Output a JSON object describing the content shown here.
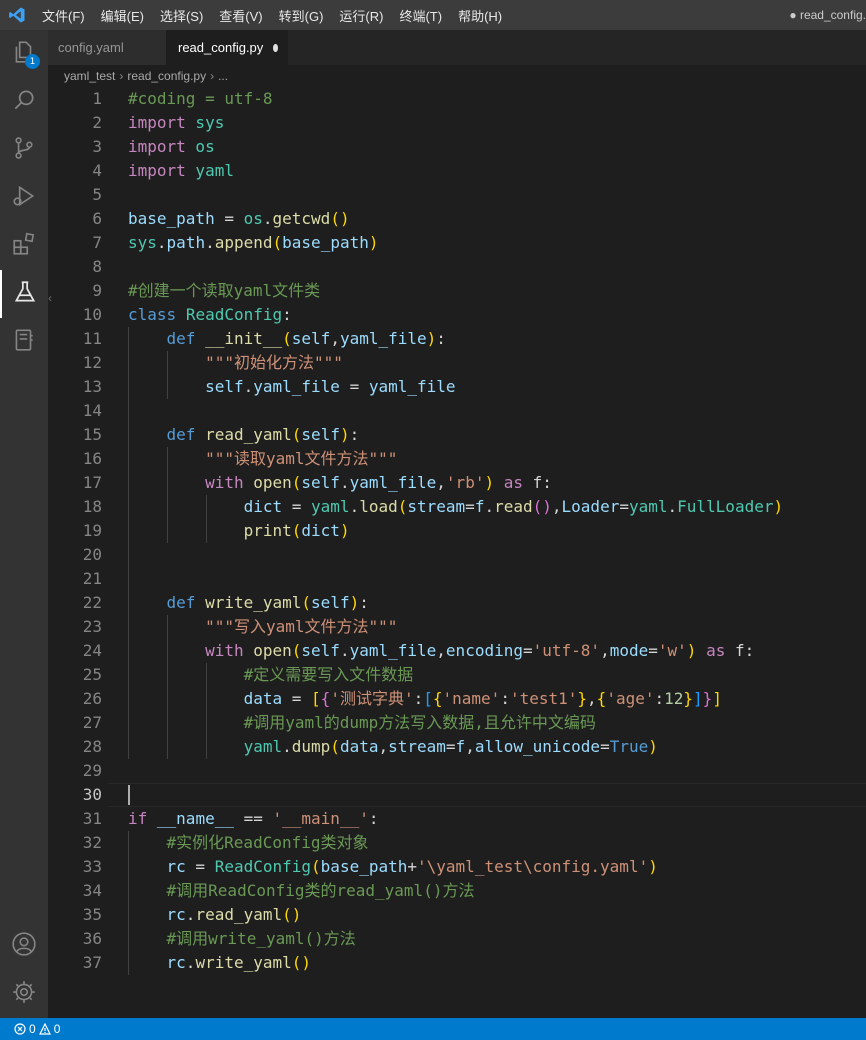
{
  "menu": [
    "文件(F)",
    "编辑(E)",
    "选择(S)",
    "查看(V)",
    "转到(G)",
    "运行(R)",
    "终端(T)",
    "帮助(H)"
  ],
  "window_title": "● read_config.",
  "activity": {
    "icons": [
      "files-icon",
      "search-icon",
      "source-control-icon",
      "run-debug-icon",
      "extensions-icon",
      "testing-icon",
      "notebook-icon",
      "account-icon",
      "settings-gear-icon"
    ],
    "explorer_badge": "1"
  },
  "tabs": [
    {
      "label": "config.yaml",
      "active": false,
      "dirty": false
    },
    {
      "label": "read_config.py",
      "active": true,
      "dirty": true
    }
  ],
  "breadcrumb": [
    "yaml_test",
    "read_config.py",
    "..."
  ],
  "editor": {
    "current_line": 30,
    "lines": [
      [
        [
          "#coding = utf-8",
          "com"
        ]
      ],
      [
        [
          "import",
          "kc"
        ],
        [
          " sys",
          "cls"
        ]
      ],
      [
        [
          "import",
          "kc"
        ],
        [
          " os",
          "cls"
        ]
      ],
      [
        [
          "import",
          "kc"
        ],
        [
          " yaml",
          "cls"
        ]
      ],
      [],
      [
        [
          "base_path",
          "var"
        ],
        [
          " = ",
          "pl"
        ],
        [
          "os",
          "cls"
        ],
        [
          ".",
          "pl"
        ],
        [
          "getcwd",
          "fn"
        ],
        [
          "()",
          "br1"
        ]
      ],
      [
        [
          "sys",
          "cls"
        ],
        [
          ".",
          "pl"
        ],
        [
          "path",
          "var"
        ],
        [
          ".",
          "pl"
        ],
        [
          "append",
          "fn"
        ],
        [
          "(",
          "br1"
        ],
        [
          "base_path",
          "var"
        ],
        [
          ")",
          "br1"
        ]
      ],
      [],
      [
        [
          "#创建一个读取yaml文件类",
          "com"
        ]
      ],
      [
        [
          "class",
          "kw"
        ],
        [
          " ",
          "pl"
        ],
        [
          "ReadConfig",
          "cls"
        ],
        [
          ":",
          "pl"
        ]
      ],
      [
        [
          "    ",
          "pl"
        ],
        [
          "def",
          "kw"
        ],
        [
          " ",
          "pl"
        ],
        [
          "__init__",
          "fn"
        ],
        [
          "(",
          "br1"
        ],
        [
          "self",
          "var"
        ],
        [
          ",",
          "pl"
        ],
        [
          "yaml_file",
          "var"
        ],
        [
          ")",
          "br1"
        ],
        [
          ":",
          "pl"
        ]
      ],
      [
        [
          "        ",
          "pl"
        ],
        [
          "\"\"\"初始化方法\"\"\"",
          "str"
        ]
      ],
      [
        [
          "        ",
          "pl"
        ],
        [
          "self",
          "var"
        ],
        [
          ".",
          "pl"
        ],
        [
          "yaml_file",
          "var"
        ],
        [
          " = ",
          "pl"
        ],
        [
          "yaml_file",
          "var"
        ]
      ],
      [],
      [
        [
          "    ",
          "pl"
        ],
        [
          "def",
          "kw"
        ],
        [
          " ",
          "pl"
        ],
        [
          "read_yaml",
          "fn"
        ],
        [
          "(",
          "br1"
        ],
        [
          "self",
          "var"
        ],
        [
          ")",
          "br1"
        ],
        [
          ":",
          "pl"
        ]
      ],
      [
        [
          "        ",
          "pl"
        ],
        [
          "\"\"\"读取yaml文件方法\"\"\"",
          "str"
        ]
      ],
      [
        [
          "        ",
          "pl"
        ],
        [
          "with",
          "kc"
        ],
        [
          " ",
          "pl"
        ],
        [
          "open",
          "fn"
        ],
        [
          "(",
          "br1"
        ],
        [
          "self",
          "var"
        ],
        [
          ".",
          "pl"
        ],
        [
          "yaml_file",
          "var"
        ],
        [
          ",",
          "pl"
        ],
        [
          "'rb'",
          "str"
        ],
        [
          ")",
          "br1"
        ],
        [
          " ",
          "pl"
        ],
        [
          "as",
          "kc"
        ],
        [
          " f:",
          "pl"
        ]
      ],
      [
        [
          "            ",
          "pl"
        ],
        [
          "dict",
          "var"
        ],
        [
          " = ",
          "pl"
        ],
        [
          "yaml",
          "cls"
        ],
        [
          ".",
          "pl"
        ],
        [
          "load",
          "fn"
        ],
        [
          "(",
          "br1"
        ],
        [
          "stream",
          "var"
        ],
        [
          "=",
          "pl"
        ],
        [
          "f",
          "var"
        ],
        [
          ".",
          "pl"
        ],
        [
          "read",
          "fn"
        ],
        [
          "()",
          "br2"
        ],
        [
          ",",
          "pl"
        ],
        [
          "Loader",
          "var"
        ],
        [
          "=",
          "pl"
        ],
        [
          "yaml",
          "cls"
        ],
        [
          ".",
          "pl"
        ],
        [
          "FullLoader",
          "cls"
        ],
        [
          ")",
          "br1"
        ]
      ],
      [
        [
          "            ",
          "pl"
        ],
        [
          "print",
          "fn"
        ],
        [
          "(",
          "br1"
        ],
        [
          "dict",
          "var"
        ],
        [
          ")",
          "br1"
        ]
      ],
      [],
      [],
      [
        [
          "    ",
          "pl"
        ],
        [
          "def",
          "kw"
        ],
        [
          " ",
          "pl"
        ],
        [
          "write_yaml",
          "fn"
        ],
        [
          "(",
          "br1"
        ],
        [
          "self",
          "var"
        ],
        [
          ")",
          "br1"
        ],
        [
          ":",
          "pl"
        ]
      ],
      [
        [
          "        ",
          "pl"
        ],
        [
          "\"\"\"写入yaml文件方法\"\"\"",
          "str"
        ]
      ],
      [
        [
          "        ",
          "pl"
        ],
        [
          "with",
          "kc"
        ],
        [
          " ",
          "pl"
        ],
        [
          "open",
          "fn"
        ],
        [
          "(",
          "br1"
        ],
        [
          "self",
          "var"
        ],
        [
          ".",
          "pl"
        ],
        [
          "yaml_file",
          "var"
        ],
        [
          ",",
          "pl"
        ],
        [
          "encoding",
          "var"
        ],
        [
          "=",
          "pl"
        ],
        [
          "'utf-8'",
          "str"
        ],
        [
          ",",
          "pl"
        ],
        [
          "mode",
          "var"
        ],
        [
          "=",
          "pl"
        ],
        [
          "'w'",
          "str"
        ],
        [
          ")",
          "br1"
        ],
        [
          " ",
          "pl"
        ],
        [
          "as",
          "kc"
        ],
        [
          " f:",
          "pl"
        ]
      ],
      [
        [
          "            ",
          "pl"
        ],
        [
          "#定义需要写入文件数据",
          "com"
        ]
      ],
      [
        [
          "            ",
          "pl"
        ],
        [
          "data",
          "var"
        ],
        [
          " = ",
          "pl"
        ],
        [
          "[",
          "br1"
        ],
        [
          "{",
          "br2"
        ],
        [
          "'测试字典'",
          "str"
        ],
        [
          ":",
          "pl"
        ],
        [
          "[",
          "br3"
        ],
        [
          "{",
          "br1"
        ],
        [
          "'name'",
          "str"
        ],
        [
          ":",
          "pl"
        ],
        [
          "'test1'",
          "str"
        ],
        [
          "}",
          "br1"
        ],
        [
          ",",
          "pl"
        ],
        [
          "{",
          "br1"
        ],
        [
          "'age'",
          "str"
        ],
        [
          ":",
          "pl"
        ],
        [
          "12",
          "num"
        ],
        [
          "}",
          "br1"
        ],
        [
          "]",
          "br3"
        ],
        [
          "}",
          "br2"
        ],
        [
          "]",
          "br1"
        ]
      ],
      [
        [
          "            ",
          "pl"
        ],
        [
          "#调用yaml的dump方法写入数据,且允许中文编码",
          "com"
        ]
      ],
      [
        [
          "            ",
          "pl"
        ],
        [
          "yaml",
          "cls"
        ],
        [
          ".",
          "pl"
        ],
        [
          "dump",
          "fn"
        ],
        [
          "(",
          "br1"
        ],
        [
          "data",
          "var"
        ],
        [
          ",",
          "pl"
        ],
        [
          "stream",
          "var"
        ],
        [
          "=",
          "pl"
        ],
        [
          "f",
          "var"
        ],
        [
          ",",
          "pl"
        ],
        [
          "allow_unicode",
          "var"
        ],
        [
          "=",
          "pl"
        ],
        [
          "True",
          "kw"
        ],
        [
          ")",
          "br1"
        ]
      ],
      [],
      [],
      [
        [
          "if",
          "kc"
        ],
        [
          " ",
          "pl"
        ],
        [
          "__name__",
          "var"
        ],
        [
          " == ",
          "pl"
        ],
        [
          "'__main__'",
          "str"
        ],
        [
          ":",
          "pl"
        ]
      ],
      [
        [
          "    ",
          "pl"
        ],
        [
          "#实例化ReadConfig类对象",
          "com"
        ]
      ],
      [
        [
          "    ",
          "pl"
        ],
        [
          "rc",
          "var"
        ],
        [
          " = ",
          "pl"
        ],
        [
          "ReadConfig",
          "cls"
        ],
        [
          "(",
          "br1"
        ],
        [
          "base_path",
          "var"
        ],
        [
          "+",
          "pl"
        ],
        [
          "'\\yaml_test\\config.yaml'",
          "str"
        ],
        [
          ")",
          "br1"
        ]
      ],
      [
        [
          "    ",
          "pl"
        ],
        [
          "#调用ReadConfig类的read_yaml()方法",
          "com"
        ]
      ],
      [
        [
          "    ",
          "pl"
        ],
        [
          "rc",
          "var"
        ],
        [
          ".",
          "pl"
        ],
        [
          "read_yaml",
          "fn"
        ],
        [
          "()",
          "br1"
        ]
      ],
      [
        [
          "    ",
          "pl"
        ],
        [
          "#调用write_yaml()方法",
          "com"
        ]
      ],
      [
        [
          "    ",
          "pl"
        ],
        [
          "rc",
          "var"
        ],
        [
          ".",
          "pl"
        ],
        [
          "write_yaml",
          "fn"
        ],
        [
          "()",
          "br1"
        ]
      ]
    ]
  },
  "status": {
    "errors": "0",
    "warnings": "0"
  }
}
